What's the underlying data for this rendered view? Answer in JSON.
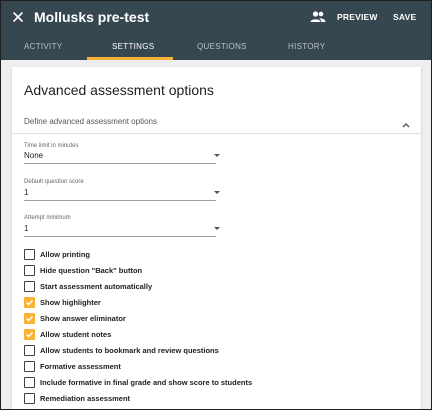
{
  "header": {
    "title": "Mollusks pre-test",
    "close_icon": "close-icon",
    "people_icon": "people-icon",
    "preview_label": "PREVIEW",
    "save_label": "SAVE",
    "background_color": "#37474f"
  },
  "tabs": [
    {
      "label": "ACTIVITY",
      "active": false
    },
    {
      "label": "SETTINGS",
      "active": true
    },
    {
      "label": "QUESTIONS",
      "active": false
    },
    {
      "label": "HISTORY",
      "active": false
    }
  ],
  "accent_color": "#f9b233",
  "section": {
    "title": "Advanced assessment options",
    "subtitle": "Define advanced assessment options",
    "collapse_icon": "chevron-up-icon"
  },
  "fields": [
    {
      "label": "Time limit in minutes",
      "value": "None"
    },
    {
      "label": "Default question score",
      "value": "1"
    },
    {
      "label": "Attempt minimum",
      "value": "1"
    }
  ],
  "options": [
    {
      "label": "Allow printing",
      "checked": false
    },
    {
      "label": "Hide question \"Back\" button",
      "checked": false
    },
    {
      "label": "Start assessment automatically",
      "checked": false
    },
    {
      "label": "Show highlighter",
      "checked": true
    },
    {
      "label": "Show answer eliminator",
      "checked": true
    },
    {
      "label": "Allow student notes",
      "checked": true
    },
    {
      "label": "Allow students to bookmark and review questions",
      "checked": false
    },
    {
      "label": "Formative assessment",
      "checked": false
    },
    {
      "label": "Include formative in final grade and show score to students",
      "checked": false
    },
    {
      "label": "Remediation assessment",
      "checked": false
    }
  ]
}
